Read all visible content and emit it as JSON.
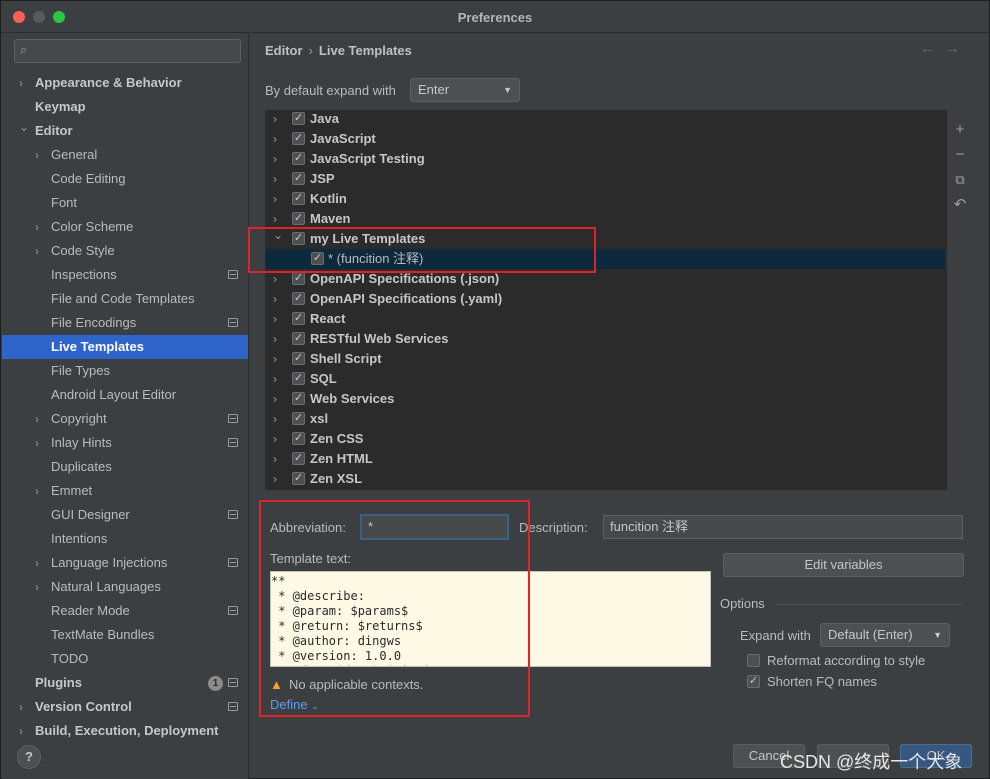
{
  "window": {
    "title": "Preferences"
  },
  "search": {
    "placeholder": "",
    "icon": "search-icon"
  },
  "sidebar": {
    "items": [
      {
        "label": "Appearance & Behavior",
        "level": 0,
        "bold": true,
        "arrow": "right"
      },
      {
        "label": "Keymap",
        "level": 0,
        "bold": true,
        "arrow": ""
      },
      {
        "label": "Editor",
        "level": 0,
        "bold": true,
        "arrow": "down"
      },
      {
        "label": "General",
        "level": 1,
        "arrow": "right"
      },
      {
        "label": "Code Editing",
        "level": 1,
        "arrow": ""
      },
      {
        "label": "Font",
        "level": 1,
        "arrow": ""
      },
      {
        "label": "Color Scheme",
        "level": 1,
        "arrow": "right"
      },
      {
        "label": "Code Style",
        "level": 1,
        "arrow": "right"
      },
      {
        "label": "Inspections",
        "level": 1,
        "arrow": "",
        "icon": true
      },
      {
        "label": "File and Code Templates",
        "level": 1,
        "arrow": ""
      },
      {
        "label": "File Encodings",
        "level": 1,
        "arrow": "",
        "icon": true
      },
      {
        "label": "Live Templates",
        "level": 1,
        "arrow": "",
        "selected": true
      },
      {
        "label": "File Types",
        "level": 1,
        "arrow": ""
      },
      {
        "label": "Android Layout Editor",
        "level": 1,
        "arrow": ""
      },
      {
        "label": "Copyright",
        "level": 1,
        "arrow": "right",
        "icon": true
      },
      {
        "label": "Inlay Hints",
        "level": 1,
        "arrow": "right",
        "icon": true
      },
      {
        "label": "Duplicates",
        "level": 1,
        "arrow": ""
      },
      {
        "label": "Emmet",
        "level": 1,
        "arrow": "right"
      },
      {
        "label": "GUI Designer",
        "level": 1,
        "arrow": "",
        "icon": true
      },
      {
        "label": "Intentions",
        "level": 1,
        "arrow": ""
      },
      {
        "label": "Language Injections",
        "level": 1,
        "arrow": "right",
        "icon": true
      },
      {
        "label": "Natural Languages",
        "level": 1,
        "arrow": "right"
      },
      {
        "label": "Reader Mode",
        "level": 1,
        "arrow": "",
        "icon": true
      },
      {
        "label": "TextMate Bundles",
        "level": 1,
        "arrow": ""
      },
      {
        "label": "TODO",
        "level": 1,
        "arrow": ""
      },
      {
        "label": "Plugins",
        "level": 0,
        "bold": true,
        "arrow": "",
        "icon": true,
        "badge": "1"
      },
      {
        "label": "Version Control",
        "level": 0,
        "bold": true,
        "arrow": "right",
        "icon": true
      },
      {
        "label": "Build, Execution, Deployment",
        "level": 0,
        "bold": true,
        "arrow": "right"
      }
    ]
  },
  "breadcrumb": {
    "parent": "Editor",
    "separator": "›",
    "current": "Live Templates"
  },
  "nav": {
    "back": "←",
    "forward": "→"
  },
  "expand": {
    "label": "By default expand with",
    "value": "Enter"
  },
  "tree": {
    "rows": [
      {
        "label": "Java",
        "expanded": false
      },
      {
        "label": "JavaScript",
        "expanded": false
      },
      {
        "label": "JavaScript Testing",
        "expanded": false
      },
      {
        "label": "JSP",
        "expanded": false
      },
      {
        "label": "Kotlin",
        "expanded": false
      },
      {
        "label": "Maven",
        "expanded": false
      },
      {
        "label": "my Live Templates",
        "expanded": true
      },
      {
        "label": "* (funcition 注释)",
        "child": true
      },
      {
        "label": "OpenAPI Specifications (.json)",
        "expanded": false
      },
      {
        "label": "OpenAPI Specifications (.yaml)",
        "expanded": false
      },
      {
        "label": "React",
        "expanded": false
      },
      {
        "label": "RESTful Web Services",
        "expanded": false
      },
      {
        "label": "Shell Script",
        "expanded": false
      },
      {
        "label": "SQL",
        "expanded": false
      },
      {
        "label": "Web Services",
        "expanded": false
      },
      {
        "label": "xsl",
        "expanded": false
      },
      {
        "label": "Zen CSS",
        "expanded": false
      },
      {
        "label": "Zen HTML",
        "expanded": false
      },
      {
        "label": "Zen XSL",
        "expanded": false
      }
    ]
  },
  "tools": {
    "add": "+",
    "remove": "−",
    "copy": "⧉",
    "restore": "↶"
  },
  "abbreviation": {
    "label": "Abbreviation:",
    "value": "*"
  },
  "description": {
    "label": "Description:",
    "value": "funcition 注释"
  },
  "template": {
    "label": "Template text:",
    "lines": [
      "**",
      " * @describe:",
      " * @param: $params$",
      " * @return: $returns$",
      " * @author: dingws",
      " * @version: 1.0.0",
      " * @date $date$ $time$"
    ]
  },
  "edit_variables": {
    "label": "Edit variables"
  },
  "options": {
    "title": "Options",
    "expand_with_label": "Expand with",
    "expand_with_value": "Default (Enter)",
    "reformat_label": "Reformat according to style",
    "reformat_checked": false,
    "shorten_label": "Shorten FQ names",
    "shorten_checked": true
  },
  "warning": {
    "text": "No applicable contexts."
  },
  "define": {
    "label": "Define"
  },
  "footer": {
    "help": "?",
    "cancel": "Cancel",
    "ok": "OK"
  },
  "watermark": "CSDN @终成一个大象",
  "colors": {
    "selection": "#2f65ca",
    "highlight_box": "#e0232a",
    "link": "#589df6",
    "warning": "#f0a732"
  }
}
